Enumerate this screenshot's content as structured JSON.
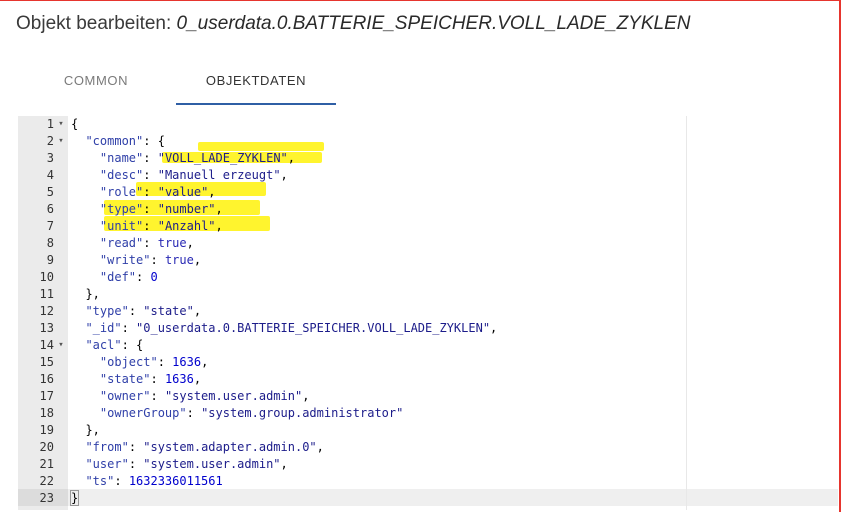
{
  "dialog": {
    "title_prefix": "Objekt bearbeiten: ",
    "object_id": "0_userdata.0.BATTERIE_SPEICHER.VOLL_LADE_ZYKLEN"
  },
  "tabs": [
    {
      "label": "COMMON",
      "active": false
    },
    {
      "label": "OBJEKTDATEN",
      "active": true
    }
  ],
  "colors": {
    "frame": "#e6352e",
    "tab_indicator": "#2f5fa5",
    "highlight": "#fff200",
    "json_key": "#2f3fa8",
    "json_number": "#0000cd"
  },
  "editor": {
    "lines": [
      {
        "n": "1",
        "fold": true,
        "tokens": [
          {
            "t": "{",
            "c": "p"
          }
        ]
      },
      {
        "n": "2",
        "fold": true,
        "tokens": [
          {
            "t": "  ",
            "c": "p"
          },
          {
            "t": "\"common\"",
            "c": "k"
          },
          {
            "t": ": {",
            "c": "p"
          }
        ]
      },
      {
        "n": "3",
        "fold": false,
        "tokens": [
          {
            "t": "    ",
            "c": "p"
          },
          {
            "t": "\"name\"",
            "c": "k"
          },
          {
            "t": ": ",
            "c": "p"
          },
          {
            "t": "\"VOLL_LADE_ZYKLEN\"",
            "c": "s"
          },
          {
            "t": ",",
            "c": "p"
          }
        ]
      },
      {
        "n": "4",
        "fold": false,
        "tokens": [
          {
            "t": "    ",
            "c": "p"
          },
          {
            "t": "\"desc\"",
            "c": "k"
          },
          {
            "t": ": ",
            "c": "p"
          },
          {
            "t": "\"Manuell erzeugt\"",
            "c": "s"
          },
          {
            "t": ",",
            "c": "p"
          }
        ]
      },
      {
        "n": "5",
        "fold": false,
        "tokens": [
          {
            "t": "    ",
            "c": "p"
          },
          {
            "t": "\"role\"",
            "c": "k"
          },
          {
            "t": ": ",
            "c": "p"
          },
          {
            "t": "\"value\"",
            "c": "s"
          },
          {
            "t": ",",
            "c": "p"
          }
        ]
      },
      {
        "n": "6",
        "fold": false,
        "tokens": [
          {
            "t": "    ",
            "c": "p"
          },
          {
            "t": "\"type\"",
            "c": "k"
          },
          {
            "t": ": ",
            "c": "p"
          },
          {
            "t": "\"number\"",
            "c": "s"
          },
          {
            "t": ",",
            "c": "p"
          }
        ]
      },
      {
        "n": "7",
        "fold": false,
        "tokens": [
          {
            "t": "    ",
            "c": "p"
          },
          {
            "t": "\"unit\"",
            "c": "k"
          },
          {
            "t": ": ",
            "c": "p"
          },
          {
            "t": "\"Anzahl\"",
            "c": "s"
          },
          {
            "t": ",",
            "c": "p"
          }
        ]
      },
      {
        "n": "8",
        "fold": false,
        "tokens": [
          {
            "t": "    ",
            "c": "p"
          },
          {
            "t": "\"read\"",
            "c": "k"
          },
          {
            "t": ": ",
            "c": "p"
          },
          {
            "t": "true",
            "c": "b"
          },
          {
            "t": ",",
            "c": "p"
          }
        ]
      },
      {
        "n": "9",
        "fold": false,
        "tokens": [
          {
            "t": "    ",
            "c": "p"
          },
          {
            "t": "\"write\"",
            "c": "k"
          },
          {
            "t": ": ",
            "c": "p"
          },
          {
            "t": "true",
            "c": "b"
          },
          {
            "t": ",",
            "c": "p"
          }
        ]
      },
      {
        "n": "10",
        "fold": false,
        "tokens": [
          {
            "t": "    ",
            "c": "p"
          },
          {
            "t": "\"def\"",
            "c": "k"
          },
          {
            "t": ": ",
            "c": "p"
          },
          {
            "t": "0",
            "c": "n"
          }
        ]
      },
      {
        "n": "11",
        "fold": false,
        "tokens": [
          {
            "t": "  },",
            "c": "p"
          }
        ]
      },
      {
        "n": "12",
        "fold": false,
        "tokens": [
          {
            "t": "  ",
            "c": "p"
          },
          {
            "t": "\"type\"",
            "c": "k"
          },
          {
            "t": ": ",
            "c": "p"
          },
          {
            "t": "\"state\"",
            "c": "s"
          },
          {
            "t": ",",
            "c": "p"
          }
        ]
      },
      {
        "n": "13",
        "fold": false,
        "tokens": [
          {
            "t": "  ",
            "c": "p"
          },
          {
            "t": "\"_id\"",
            "c": "k"
          },
          {
            "t": ": ",
            "c": "p"
          },
          {
            "t": "\"0_userdata.0.BATTERIE_SPEICHER.VOLL_LADE_ZYKLEN\"",
            "c": "s"
          },
          {
            "t": ",",
            "c": "p"
          }
        ]
      },
      {
        "n": "14",
        "fold": true,
        "tokens": [
          {
            "t": "  ",
            "c": "p"
          },
          {
            "t": "\"acl\"",
            "c": "k"
          },
          {
            "t": ": {",
            "c": "p"
          }
        ]
      },
      {
        "n": "15",
        "fold": false,
        "tokens": [
          {
            "t": "    ",
            "c": "p"
          },
          {
            "t": "\"object\"",
            "c": "k"
          },
          {
            "t": ": ",
            "c": "p"
          },
          {
            "t": "1636",
            "c": "n"
          },
          {
            "t": ",",
            "c": "p"
          }
        ]
      },
      {
        "n": "16",
        "fold": false,
        "tokens": [
          {
            "t": "    ",
            "c": "p"
          },
          {
            "t": "\"state\"",
            "c": "k"
          },
          {
            "t": ": ",
            "c": "p"
          },
          {
            "t": "1636",
            "c": "n"
          },
          {
            "t": ",",
            "c": "p"
          }
        ]
      },
      {
        "n": "17",
        "fold": false,
        "tokens": [
          {
            "t": "    ",
            "c": "p"
          },
          {
            "t": "\"owner\"",
            "c": "k"
          },
          {
            "t": ": ",
            "c": "p"
          },
          {
            "t": "\"system.user.admin\"",
            "c": "s"
          },
          {
            "t": ",",
            "c": "p"
          }
        ]
      },
      {
        "n": "18",
        "fold": false,
        "tokens": [
          {
            "t": "    ",
            "c": "p"
          },
          {
            "t": "\"ownerGroup\"",
            "c": "k"
          },
          {
            "t": ": ",
            "c": "p"
          },
          {
            "t": "\"system.group.administrator\"",
            "c": "s"
          }
        ]
      },
      {
        "n": "19",
        "fold": false,
        "tokens": [
          {
            "t": "  },",
            "c": "p"
          }
        ]
      },
      {
        "n": "20",
        "fold": false,
        "tokens": [
          {
            "t": "  ",
            "c": "p"
          },
          {
            "t": "\"from\"",
            "c": "k"
          },
          {
            "t": ": ",
            "c": "p"
          },
          {
            "t": "\"system.adapter.admin.0\"",
            "c": "s"
          },
          {
            "t": ",",
            "c": "p"
          }
        ]
      },
      {
        "n": "21",
        "fold": false,
        "tokens": [
          {
            "t": "  ",
            "c": "p"
          },
          {
            "t": "\"user\"",
            "c": "k"
          },
          {
            "t": ": ",
            "c": "p"
          },
          {
            "t": "\"system.user.admin\"",
            "c": "s"
          },
          {
            "t": ",",
            "c": "p"
          }
        ]
      },
      {
        "n": "22",
        "fold": false,
        "tokens": [
          {
            "t": "  ",
            "c": "p"
          },
          {
            "t": "\"ts\"",
            "c": "k"
          },
          {
            "t": ": ",
            "c": "p"
          },
          {
            "t": "1632336011561",
            "c": "n"
          }
        ]
      },
      {
        "n": "23",
        "fold": false,
        "active": true,
        "tokens": [
          {
            "t": "}",
            "c": "p"
          }
        ]
      }
    ]
  }
}
